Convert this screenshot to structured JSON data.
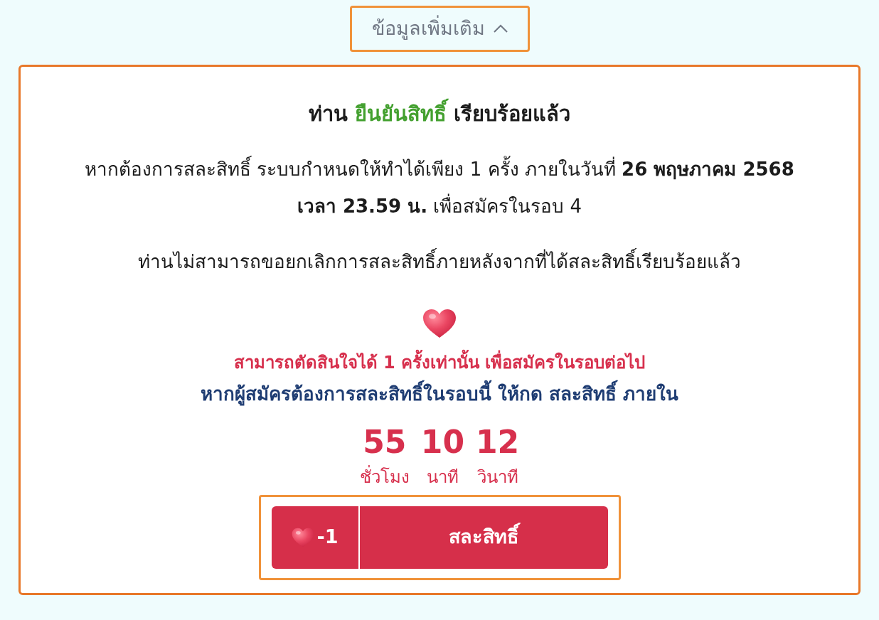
{
  "more_info_toggle": {
    "label": "ข้อมูลเพิ่มเติม",
    "expanded": true
  },
  "confirmation": {
    "title": {
      "prefix": "ท่าน",
      "status": "ยืนยันสิทธิ์",
      "suffix": "เรียบร้อยแล้ว"
    },
    "paragraphs": [
      "หากต้องการสละสิทธิ์ ระบบกำหนดให้ทำได้เพียง 1 ครั้ง ภายในวันที่ **26 พฤษภาคม 2568 เวลา 23.59 น.** เพื่อสมัครในรอบ 4",
      "ท่านไม่สามารถขอยกเลิกการสละสิทธิ์ภายหลังจากที่ได้สละสิทธิ์เรียบร้อยแล้ว"
    ],
    "warning": "สามารถตัดสินใจได้ 1 ครั้งเท่านั้น เพื่อสมัครในรอบต่อไป",
    "instruction": "หากผู้สมัครต้องการสละสิทธิ์ในรอบนี้ ให้กด สละสิทธิ์ ภายใน",
    "countdown": [
      {
        "value": "55",
        "unit": "ชั่วโมง"
      },
      {
        "value": "10",
        "unit": "นาที"
      },
      {
        "value": "12",
        "unit": "วินาที"
      }
    ],
    "waive_button": {
      "cost": "-1",
      "label": "สละสิทธิ์"
    }
  }
}
